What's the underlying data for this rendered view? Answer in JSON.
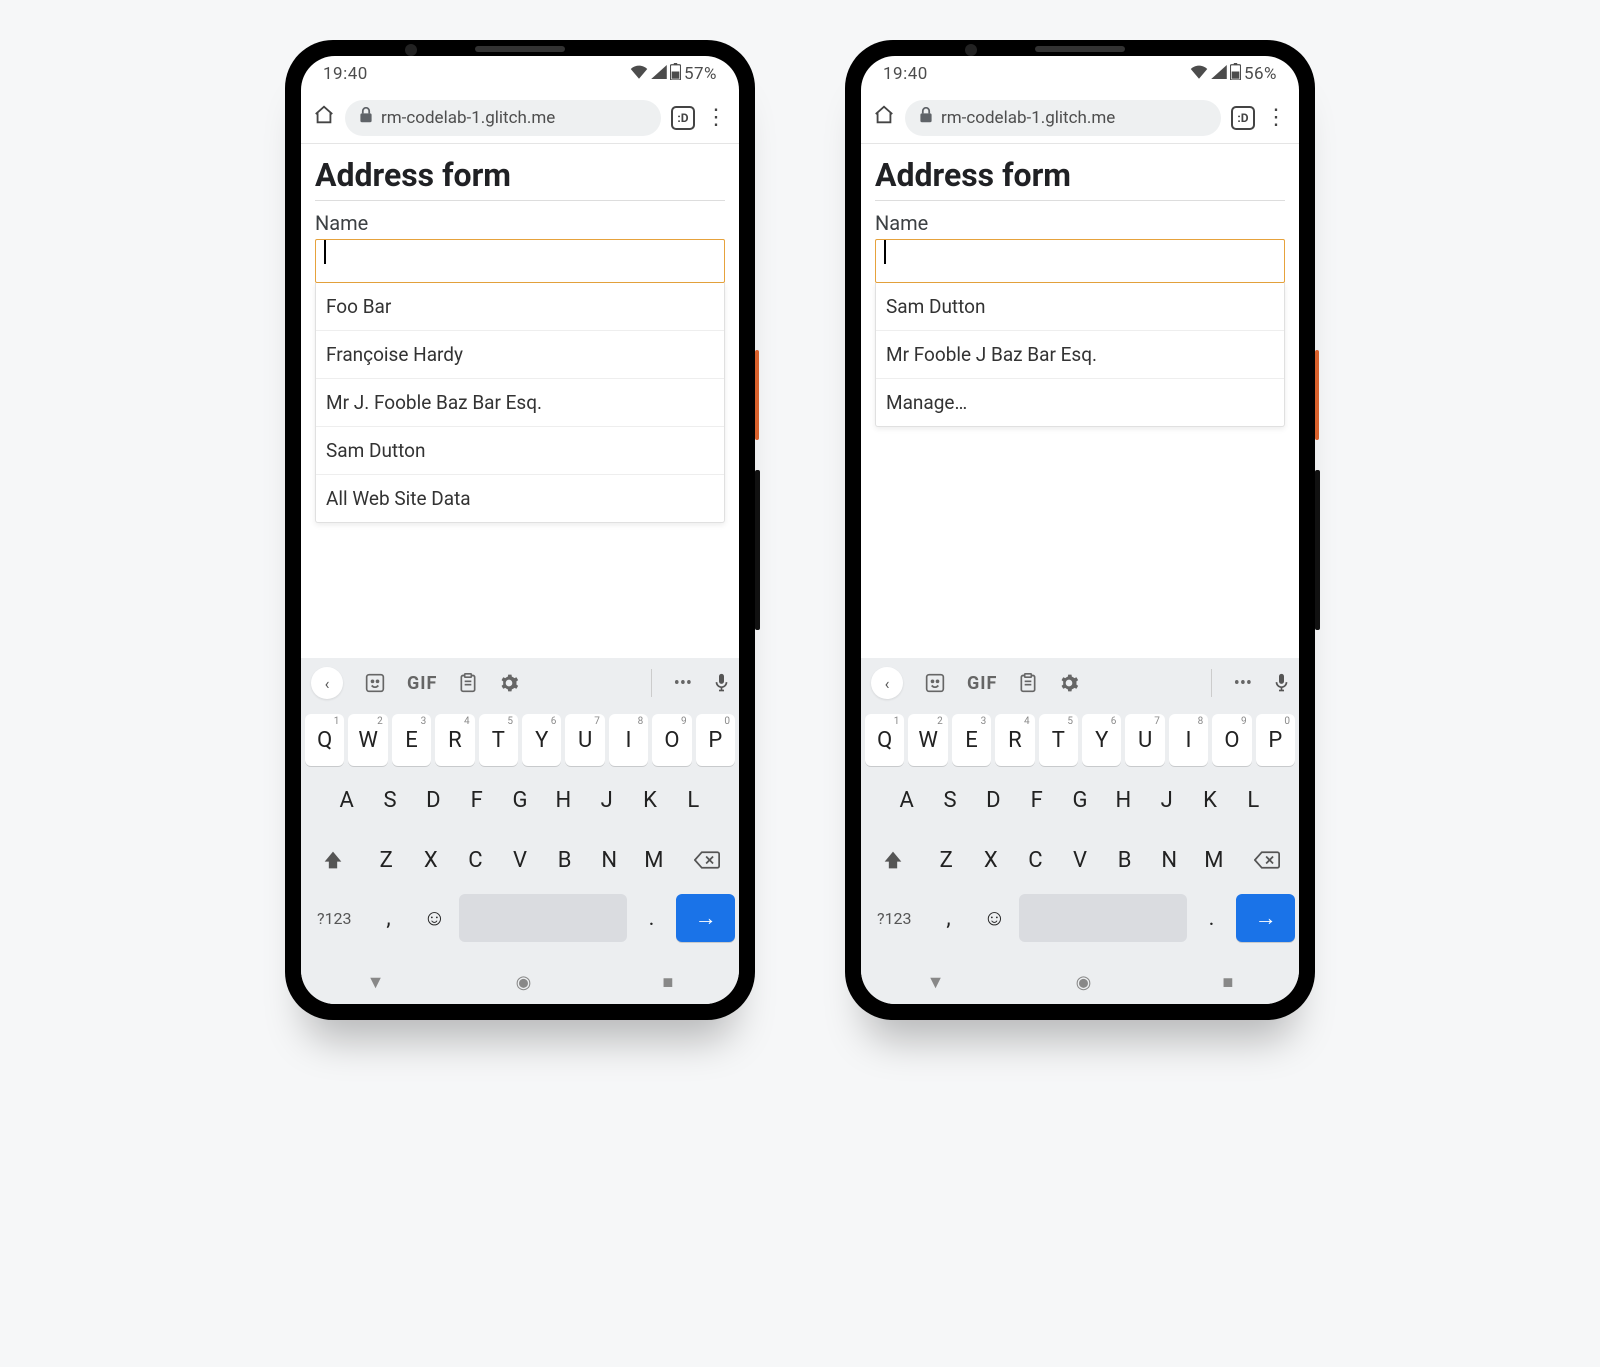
{
  "phones": [
    {
      "status": {
        "time": "19:40",
        "battery": "57%"
      },
      "url": "rm-codelab-1.glitch.me",
      "page_title": "Address form",
      "field_label": "Name",
      "suggestions": [
        "Foo Bar",
        "Françoise Hardy",
        "Mr J. Fooble Baz Bar Esq.",
        "Sam Dutton",
        "All Web Site Data"
      ]
    },
    {
      "status": {
        "time": "19:40",
        "battery": "56%"
      },
      "url": "rm-codelab-1.glitch.me",
      "page_title": "Address form",
      "field_label": "Name",
      "suggestions": [
        "Sam Dutton",
        "Mr Fooble J Baz Bar Esq.",
        "Manage…"
      ]
    }
  ],
  "keyboard": {
    "row1": [
      "Q",
      "W",
      "E",
      "R",
      "T",
      "Y",
      "U",
      "I",
      "O",
      "P"
    ],
    "row1_super": [
      "1",
      "2",
      "3",
      "4",
      "5",
      "6",
      "7",
      "8",
      "9",
      "0"
    ],
    "row2": [
      "A",
      "S",
      "D",
      "F",
      "G",
      "H",
      "J",
      "K",
      "L"
    ],
    "row3": [
      "Z",
      "X",
      "C",
      "V",
      "B",
      "N",
      "M"
    ],
    "sym_label": "?123",
    "gif_label": "GIF"
  }
}
